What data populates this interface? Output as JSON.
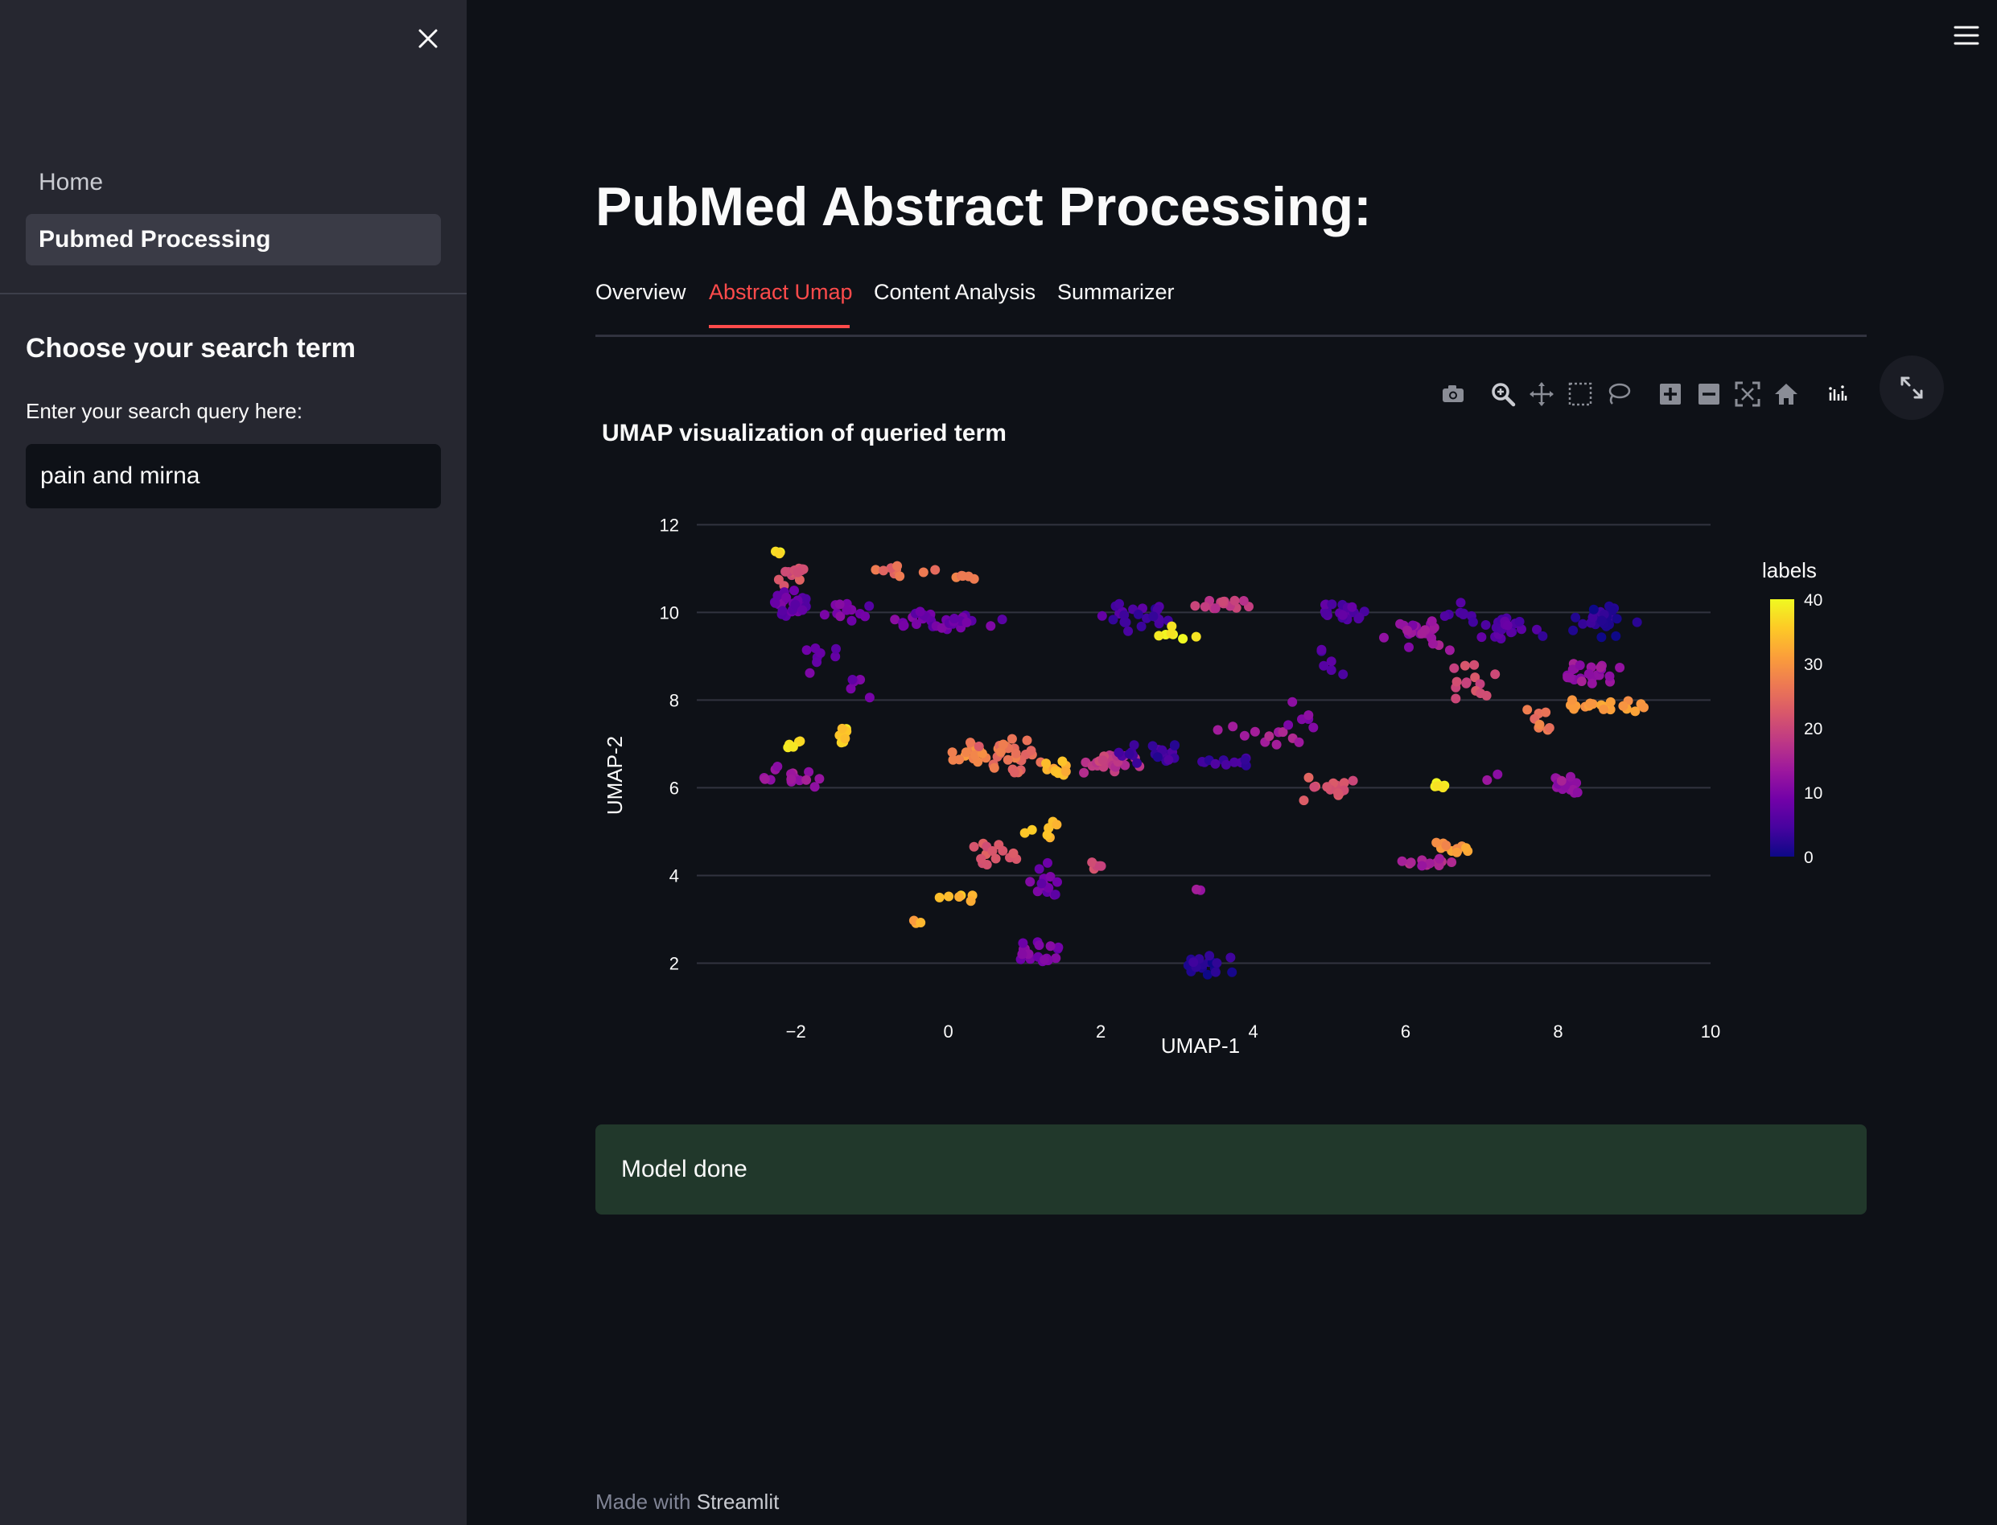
{
  "sidebar": {
    "nav": [
      {
        "label": "Home"
      },
      {
        "label": "Pubmed Processing"
      }
    ],
    "heading": "Choose your search term",
    "query_label": "Enter your search query here:",
    "query_value": "pain and mirna"
  },
  "main": {
    "title": "PubMed Abstract Processing:",
    "tabs": [
      {
        "label": "Overview"
      },
      {
        "label": "Abstract Umap"
      },
      {
        "label": "Content Analysis"
      },
      {
        "label": "Summarizer"
      }
    ],
    "active_tab": "Abstract Umap",
    "alert": "Model done",
    "footer_prefix": "Made with",
    "footer_brand": "Streamlit"
  },
  "modebar_icons": [
    "camera-icon",
    "zoom-icon",
    "pan-icon",
    "box-select-icon",
    "lasso-select-icon",
    "zoom-in-icon",
    "zoom-out-icon",
    "autoscale-icon",
    "reset-axes-icon",
    "plotly-logo-icon"
  ],
  "colors": {
    "accent": "#ff4b4b",
    "success_bg": "#21382b",
    "colorscale": [
      "#0d0887",
      "#46039f",
      "#7201a8",
      "#9c179e",
      "#bd3786",
      "#d8576b",
      "#ed7953",
      "#fb9f3a",
      "#fdca26",
      "#f0f921"
    ]
  },
  "chart_data": {
    "type": "scatter",
    "title": "UMAP visualization of queried term",
    "xlabel": "UMAP-1",
    "ylabel": "UMAP-2",
    "xlim": [
      -3.3,
      10
    ],
    "ylim": [
      1.0,
      12.3
    ],
    "xticks": [
      "−2",
      "0",
      "2",
      "4",
      "6",
      "8",
      "10"
    ],
    "yticks": [
      "2",
      "4",
      "6",
      "8",
      "10",
      "12"
    ],
    "grid": "horizontal",
    "colorbar": {
      "title": "labels",
      "min": 0,
      "max": 40,
      "ticks": [
        "0",
        "10",
        "20",
        "30",
        "40"
      ]
    },
    "clusters": [
      {
        "cx": -2.25,
        "cy": 11.35,
        "sx": 0.08,
        "sy": 0.06,
        "n": 3,
        "label": 38
      },
      {
        "cx": -2.0,
        "cy": 10.9,
        "sx": 0.25,
        "sy": 0.2,
        "n": 14,
        "label": 21
      },
      {
        "cx": -2.1,
        "cy": 10.2,
        "sx": 0.3,
        "sy": 0.25,
        "n": 30,
        "label": 8
      },
      {
        "cx": -1.4,
        "cy": 10.0,
        "sx": 0.4,
        "sy": 0.2,
        "n": 12,
        "label": 9
      },
      {
        "cx": -1.65,
        "cy": 9.1,
        "sx": 0.3,
        "sy": 0.4,
        "n": 8,
        "label": 9
      },
      {
        "cx": -0.65,
        "cy": 10.9,
        "sx": 0.35,
        "sy": 0.2,
        "n": 10,
        "label": 26
      },
      {
        "cx": 0.2,
        "cy": 10.8,
        "sx": 0.15,
        "sy": 0.1,
        "n": 5,
        "label": 27
      },
      {
        "cx": -0.3,
        "cy": 9.8,
        "sx": 0.5,
        "sy": 0.2,
        "n": 20,
        "label": 9
      },
      {
        "cx": 0.3,
        "cy": 9.8,
        "sx": 0.3,
        "sy": 0.15,
        "n": 12,
        "label": 8
      },
      {
        "cx": -1.2,
        "cy": 8.2,
        "sx": 0.15,
        "sy": 0.35,
        "n": 5,
        "label": 9
      },
      {
        "cx": -2.0,
        "cy": 6.2,
        "sx": 0.3,
        "sy": 0.2,
        "n": 16,
        "label": 13
      },
      {
        "cx": -2.0,
        "cy": 7.0,
        "sx": 0.12,
        "sy": 0.1,
        "n": 5,
        "label": 38
      },
      {
        "cx": -1.4,
        "cy": 7.2,
        "sx": 0.15,
        "sy": 0.2,
        "n": 8,
        "label": 36
      },
      {
        "cx": 0.3,
        "cy": 6.8,
        "sx": 0.3,
        "sy": 0.25,
        "n": 16,
        "label": 28
      },
      {
        "cx": 0.85,
        "cy": 6.7,
        "sx": 0.4,
        "sy": 0.35,
        "n": 28,
        "label": 25
      },
      {
        "cx": 1.4,
        "cy": 6.4,
        "sx": 0.2,
        "sy": 0.15,
        "n": 12,
        "label": 33
      },
      {
        "cx": 1.2,
        "cy": 5.0,
        "sx": 0.25,
        "sy": 0.3,
        "n": 8,
        "label": 35
      },
      {
        "cx": 0.6,
        "cy": 4.4,
        "sx": 0.35,
        "sy": 0.3,
        "n": 14,
        "label": 22
      },
      {
        "cx": 1.9,
        "cy": 4.2,
        "sx": 0.12,
        "sy": 0.1,
        "n": 5,
        "label": 20
      },
      {
        "cx": 0.1,
        "cy": 3.5,
        "sx": 0.25,
        "sy": 0.12,
        "n": 6,
        "label": 34
      },
      {
        "cx": -0.4,
        "cy": 3.0,
        "sx": 0.1,
        "sy": 0.08,
        "n": 3,
        "label": 32
      },
      {
        "cx": 1.25,
        "cy": 3.8,
        "sx": 0.2,
        "sy": 0.35,
        "n": 14,
        "label": 9
      },
      {
        "cx": 1.2,
        "cy": 2.2,
        "sx": 0.3,
        "sy": 0.3,
        "n": 22,
        "label": 10
      },
      {
        "cx": 2.0,
        "cy": 6.6,
        "sx": 0.4,
        "sy": 0.2,
        "n": 22,
        "label": 18
      },
      {
        "cx": 2.7,
        "cy": 6.8,
        "sx": 0.5,
        "sy": 0.25,
        "n": 22,
        "label": 4
      },
      {
        "cx": 2.5,
        "cy": 9.9,
        "sx": 0.35,
        "sy": 0.25,
        "n": 24,
        "label": 5
      },
      {
        "cx": 3.0,
        "cy": 9.5,
        "sx": 0.3,
        "sy": 0.15,
        "n": 7,
        "label": 38
      },
      {
        "cx": 3.65,
        "cy": 10.2,
        "sx": 0.4,
        "sy": 0.15,
        "n": 14,
        "label": 19
      },
      {
        "cx": 4.1,
        "cy": 7.2,
        "sx": 0.6,
        "sy": 0.25,
        "n": 12,
        "label": 15
      },
      {
        "cx": 3.5,
        "cy": 6.6,
        "sx": 0.5,
        "sy": 0.12,
        "n": 12,
        "label": 4
      },
      {
        "cx": 3.4,
        "cy": 1.9,
        "sx": 0.35,
        "sy": 0.25,
        "n": 20,
        "label": 2
      },
      {
        "cx": 3.3,
        "cy": 3.7,
        "sx": 0.05,
        "sy": 0.05,
        "n": 2,
        "label": 12
      },
      {
        "cx": 5.25,
        "cy": 10.0,
        "sx": 0.4,
        "sy": 0.2,
        "n": 22,
        "label": 6
      },
      {
        "cx": 5.0,
        "cy": 8.7,
        "sx": 0.3,
        "sy": 0.4,
        "n": 6,
        "label": 6
      },
      {
        "cx": 4.6,
        "cy": 7.6,
        "sx": 0.3,
        "sy": 0.25,
        "n": 6,
        "label": 12
      },
      {
        "cx": 5.1,
        "cy": 6.0,
        "sx": 0.45,
        "sy": 0.3,
        "n": 16,
        "label": 22
      },
      {
        "cx": 6.2,
        "cy": 9.5,
        "sx": 0.45,
        "sy": 0.3,
        "n": 22,
        "label": 13
      },
      {
        "cx": 6.7,
        "cy": 9.9,
        "sx": 0.3,
        "sy": 0.2,
        "n": 8,
        "label": 5
      },
      {
        "cx": 7.3,
        "cy": 9.7,
        "sx": 0.4,
        "sy": 0.25,
        "n": 22,
        "label": 6
      },
      {
        "cx": 8.6,
        "cy": 9.8,
        "sx": 0.4,
        "sy": 0.3,
        "n": 30,
        "label": 2
      },
      {
        "cx": 7.0,
        "cy": 8.4,
        "sx": 0.3,
        "sy": 0.35,
        "n": 14,
        "label": 21
      },
      {
        "cx": 8.4,
        "cy": 8.6,
        "sx": 0.35,
        "sy": 0.25,
        "n": 22,
        "label": 13
      },
      {
        "cx": 8.6,
        "cy": 7.9,
        "sx": 0.4,
        "sy": 0.15,
        "n": 16,
        "label": 30
      },
      {
        "cx": 9.1,
        "cy": 7.85,
        "sx": 0.1,
        "sy": 0.08,
        "n": 3,
        "label": 31
      },
      {
        "cx": 7.8,
        "cy": 7.5,
        "sx": 0.15,
        "sy": 0.3,
        "n": 8,
        "label": 26
      },
      {
        "cx": 8.1,
        "cy": 6.0,
        "sx": 0.25,
        "sy": 0.3,
        "n": 16,
        "label": 12
      },
      {
        "cx": 6.45,
        "cy": 6.05,
        "sx": 0.08,
        "sy": 0.06,
        "n": 6,
        "label": 38
      },
      {
        "cx": 6.6,
        "cy": 4.6,
        "sx": 0.2,
        "sy": 0.2,
        "n": 12,
        "label": 30
      },
      {
        "cx": 6.3,
        "cy": 4.3,
        "sx": 0.25,
        "sy": 0.1,
        "n": 14,
        "label": 15
      },
      {
        "cx": 7.2,
        "cy": 6.2,
        "sx": 0.15,
        "sy": 0.15,
        "n": 2,
        "label": 12
      }
    ]
  }
}
